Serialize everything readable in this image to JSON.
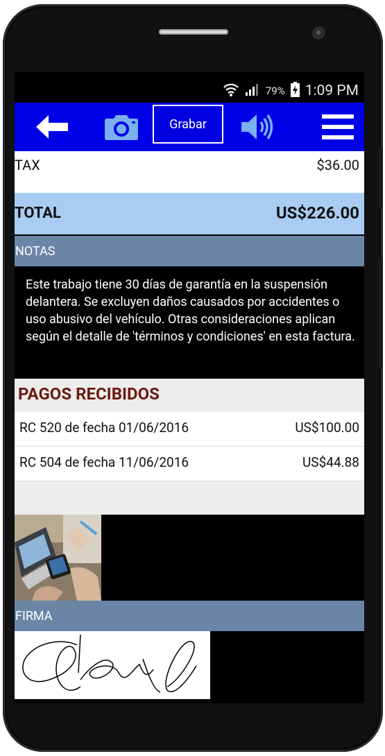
{
  "status_bar": {
    "battery_percent": "79%",
    "time": "1:09 PM"
  },
  "toolbar": {
    "back_icon": "arrow-left-icon",
    "camera_icon": "camera-icon",
    "record_label": "Grabar",
    "speaker_icon": "speaker-icon",
    "menu_icon": "menu-icon",
    "background_color": "#0000e6"
  },
  "invoice": {
    "tax_label": "TAX",
    "tax_value": "$36.00",
    "total_label": "TOTAL",
    "total_value": "US$226.00"
  },
  "notes": {
    "header": "NOTAS",
    "text": "Este trabajo tiene 30 días de garantía en la suspensión delantera. Se excluyen daños causados por accidentes o uso abusivo del vehículo. Otras consideraciones aplican según el detalle de 'términos y condiciones' en esta factura."
  },
  "payments": {
    "title": "PAGOS RECIBIDOS",
    "items": [
      {
        "description": "RC 520 de fecha 01/06/2016",
        "amount": "US$100.00"
      },
      {
        "description": "RC 504 de fecha 11/06/2016",
        "amount": "US$44.88"
      }
    ]
  },
  "signature": {
    "header": "FIRMA"
  }
}
